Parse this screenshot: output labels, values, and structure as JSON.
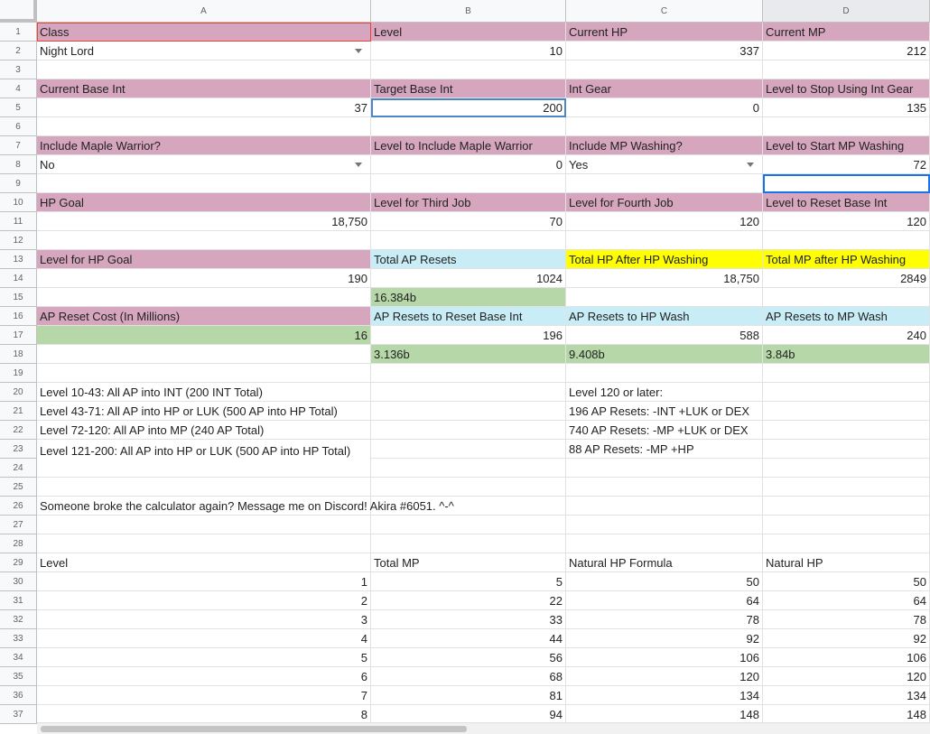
{
  "columns": [
    "A",
    "B",
    "C",
    "D"
  ],
  "rows": [
    "1",
    "2",
    "3",
    "4",
    "5",
    "6",
    "7",
    "8",
    "9",
    "10",
    "11",
    "12",
    "13",
    "14",
    "15",
    "16",
    "17",
    "18",
    "19",
    "20",
    "21",
    "22",
    "23",
    "24",
    "25",
    "26",
    "27",
    "28",
    "29",
    "30",
    "31",
    "32",
    "33",
    "34",
    "35",
    "36",
    "37"
  ],
  "cells": {
    "A1": "Class",
    "B1": "Level",
    "C1": "Current HP",
    "D1": "Current MP",
    "A2": "Night Lord",
    "B2": "10",
    "C2": "337",
    "D2": "212",
    "A4": "Current Base Int",
    "B4": "Target Base Int",
    "C4": "Int Gear",
    "D4": "Level to Stop Using Int Gear",
    "A5": "37",
    "B5": "200",
    "C5": "0",
    "D5": "135",
    "A7": "Include Maple Warrior?",
    "B7": "Level to Include Maple Warrior",
    "C7": "Include MP Washing?",
    "D7": "Level to Start MP Washing",
    "A8": "No",
    "B8": "0",
    "C8": "Yes",
    "D8": "72",
    "A10": "HP Goal",
    "B10": "Level for Third Job",
    "C10": "Level for Fourth Job",
    "D10": "Level to Reset Base Int",
    "A11": "18,750",
    "B11": "70",
    "C11": "120",
    "D11": "120",
    "A13": "Level for HP Goal",
    "B13": "Total AP Resets",
    "C13": "Total HP After HP Washing",
    "D13": "Total MP after HP Washing",
    "A14": "190",
    "B14": "1024",
    "C14": "18,750",
    "D14": "2849",
    "B15": "16.384b",
    "A16": "AP Reset Cost (In Millions)",
    "B16": "AP Resets to Reset Base Int",
    "C16": "AP Resets to HP Wash",
    "D16": "AP Resets to MP Wash",
    "A17": "16",
    "B17": "196",
    "C17": "588",
    "D17": "240",
    "B18": "3.136b",
    "C18": "9.408b",
    "D18": "3.84b",
    "A20": "Level 10-43: All AP into INT (200 INT Total)",
    "A21": "Level 43-71: All AP into HP or LUK (500 AP into HP Total)",
    "A22": "Level 72-120: All AP into MP (240 AP Total)",
    "A23": "Level 121-200: All AP into HP or LUK (500 AP into HP Total)",
    "C20": "Level 120 or later:",
    "C21": "196 AP Resets: -INT +LUK or DEX",
    "C22": "740 AP Resets: -MP +LUK or DEX",
    "C23": "88 AP Resets: -MP +HP",
    "A26": "Someone broke the calculator again? Message me on Discord! Akira #6051. ^-^",
    "A29": "Level",
    "B29": "Total MP",
    "C29": "Natural HP Formula",
    "D29": "Natural HP"
  },
  "table": [
    [
      "1",
      "5",
      "50",
      "50"
    ],
    [
      "2",
      "22",
      "64",
      "64"
    ],
    [
      "3",
      "33",
      "78",
      "78"
    ],
    [
      "4",
      "44",
      "92",
      "92"
    ],
    [
      "5",
      "56",
      "106",
      "106"
    ],
    [
      "6",
      "68",
      "120",
      "120"
    ],
    [
      "7",
      "81",
      "134",
      "134"
    ],
    [
      "8",
      "94",
      "148",
      "148"
    ]
  ]
}
